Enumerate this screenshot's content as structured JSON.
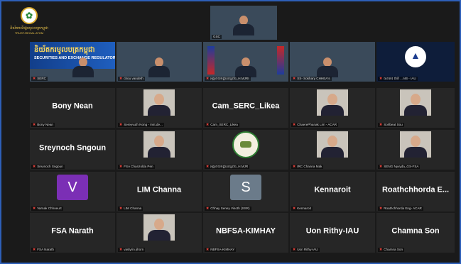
{
  "logo": {
    "emblem": "✿",
    "line1": "និយ័តករទីផ្សារមូលបត្រកម្ពុជា",
    "line2": "TRUST-REGAL.ATOM"
  },
  "speaker": {
    "label": "GSC"
  },
  "video_row": [
    {
      "label": "SERC",
      "banner_kh": "និយ័តករមូលបត្រកម្ពុជា",
      "banner_en": "SECURITIES AND EXCHANGE REGULATOR OF CAMBODIA"
    },
    {
      "label": "chou vandeth"
    },
    {
      "label": "អគ្គនាយកដ្ឋានពន្ធដារ_H.MJRI"
    },
    {
      "label": "SS- Sokhary CHHEA's"
    },
    {
      "label": "ធនាគារ ជាតិ ...nIB - IAU"
    }
  ],
  "grid": [
    {
      "type": "text",
      "big": "Bony Nean",
      "label": "Bony Nean"
    },
    {
      "type": "photo",
      "label": "Sereyvuth Nong - Inst.de..."
    },
    {
      "type": "text",
      "big": "Cam_SERC_Likea",
      "label": "Cam_SERC_Likea"
    },
    {
      "type": "photo",
      "label": "ChaerePhanak Lim - ACAR"
    },
    {
      "type": "photo",
      "label": "Sorlbeat Sou"
    },
    {
      "type": "text",
      "big": "Sreynoch Sngoun",
      "label": "Sreynoch Sngoun"
    },
    {
      "type": "photo",
      "label": "FSA Chanzolda Pen"
    },
    {
      "type": "seal",
      "label": "អគ្គនាយកដ្ឋានពន្ធដារ_H.MJR"
    },
    {
      "type": "photo",
      "label": "IRC Channa Mak"
    },
    {
      "type": "photo",
      "label": "SENG Nyvyda_GS-FSA"
    },
    {
      "type": "letter",
      "letter": "V",
      "color": "#7b2fb5",
      "label": "Varnak Chhoeurt"
    },
    {
      "type": "text",
      "big": "LIM Channa",
      "label": "LIM Channa"
    },
    {
      "type": "letter",
      "letter": "S",
      "color": "#6b7b8a",
      "label": "Chhay Seney Visoth (SSR)"
    },
    {
      "type": "text",
      "big": "Kennaroit",
      "label": "Kennaroit"
    },
    {
      "type": "text",
      "big": "Roathchhorda E...",
      "label": "Roathchhorda Eng- ACAR"
    },
    {
      "type": "text",
      "big": "FSA Narath",
      "label": "FSA Narath"
    },
    {
      "type": "photo",
      "label": "vaslyrin jihorn"
    },
    {
      "type": "text",
      "big": "NBFSA-KIMHAY",
      "label": "NBFSA-KIMHAY"
    },
    {
      "type": "text",
      "big": "Uon Rithy-IAU",
      "label": "Uon Rithy-IAU"
    },
    {
      "type": "text",
      "big": "Chamna Son",
      "label": "Chamna Son"
    }
  ]
}
